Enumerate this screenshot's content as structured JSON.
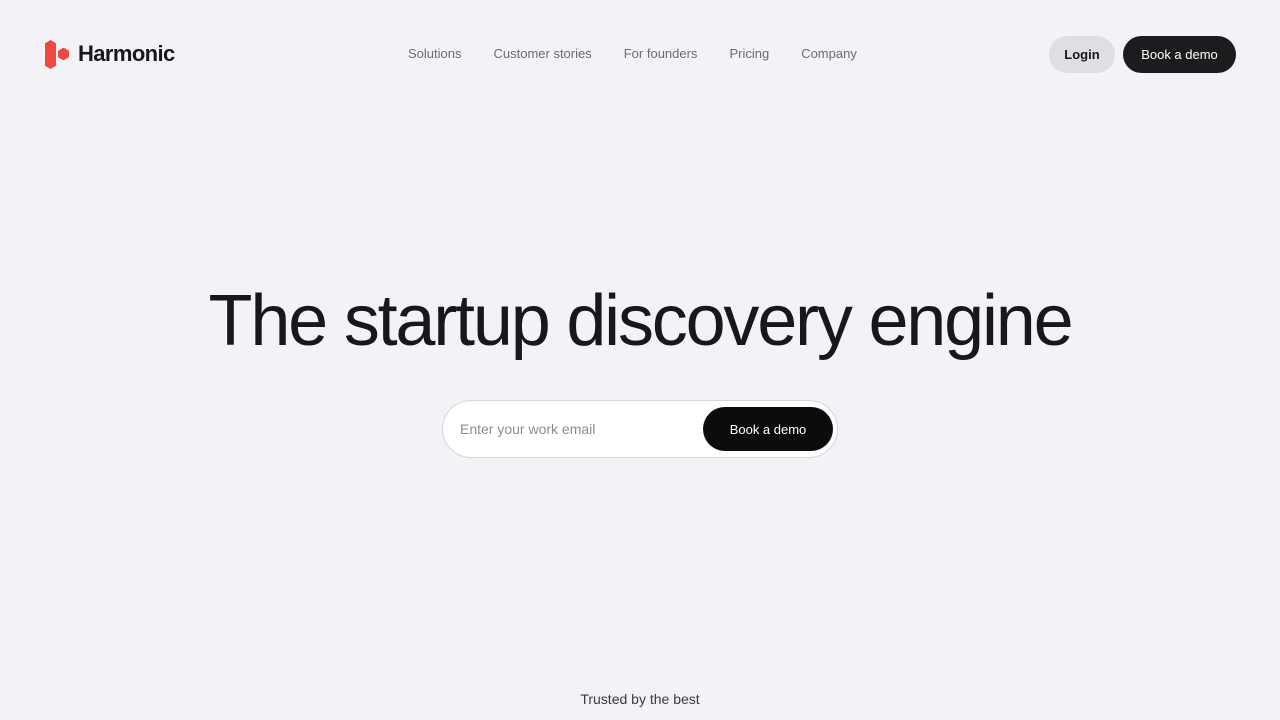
{
  "brand": {
    "name": "Harmonic",
    "logo_icon": "hexagon-cluster-icon",
    "accent_color": "#f0483e"
  },
  "nav": {
    "items": [
      {
        "label": "Solutions"
      },
      {
        "label": "Customer stories"
      },
      {
        "label": "For founders"
      },
      {
        "label": "Pricing"
      },
      {
        "label": "Company"
      }
    ]
  },
  "header": {
    "login_label": "Login",
    "demo_label": "Book a demo"
  },
  "hero": {
    "title": "The startup discovery engine",
    "email_placeholder": "Enter your work email",
    "email_value": "",
    "cta_label": "Book a demo"
  },
  "trusted": {
    "label": "Trusted by the best"
  }
}
